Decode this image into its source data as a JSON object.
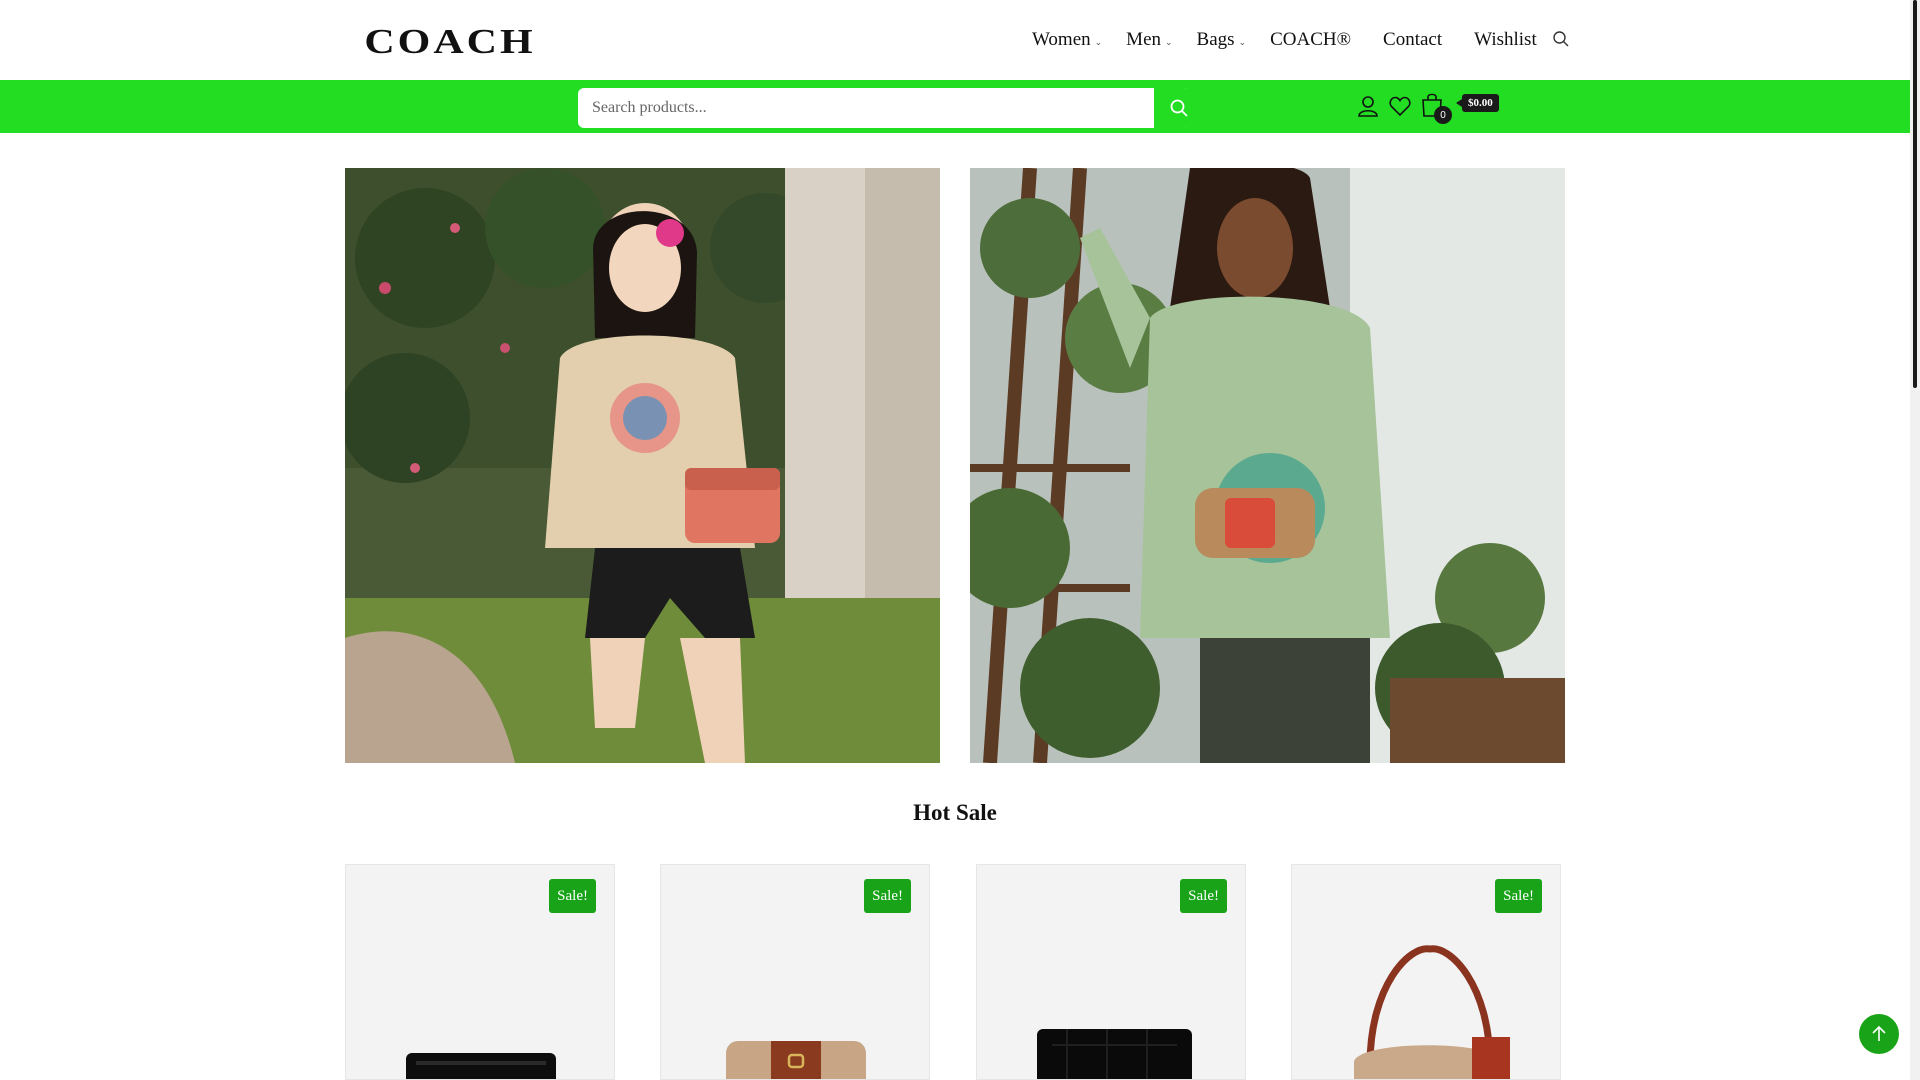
{
  "header": {
    "logo_text": "COACH",
    "nav": [
      {
        "label": "Women",
        "has_dropdown": true
      },
      {
        "label": "Men",
        "has_dropdown": true
      },
      {
        "label": "Bags",
        "has_dropdown": true
      },
      {
        "label": "COACH®",
        "has_dropdown": false
      },
      {
        "label": "Contact",
        "has_dropdown": false
      },
      {
        "label": "Wishlist",
        "has_dropdown": false
      }
    ],
    "search_icon": "search-icon"
  },
  "toolbar": {
    "search_placeholder": "Search products...",
    "search_value": "",
    "cart_count": "0",
    "cart_total": "$0.00",
    "accent_color": "#22dd22"
  },
  "banners": [
    {
      "name": "women-banner",
      "description_icon": "woman-with-mickey-bag-photo"
    },
    {
      "name": "men-banner",
      "description_icon": "man-with-mickey-belt-bag-photo"
    }
  ],
  "section": {
    "title": "Hot Sale"
  },
  "products": [
    {
      "badge": "Sale!",
      "icon": "black-card-case-photo"
    },
    {
      "badge": "Sale!",
      "icon": "signature-wallet-photo"
    },
    {
      "badge": "Sale!",
      "icon": "black-croc-card-case-photo"
    },
    {
      "badge": "Sale!",
      "icon": "signature-shoulder-bag-photo"
    }
  ],
  "back_to_top": "arrow-up-icon"
}
